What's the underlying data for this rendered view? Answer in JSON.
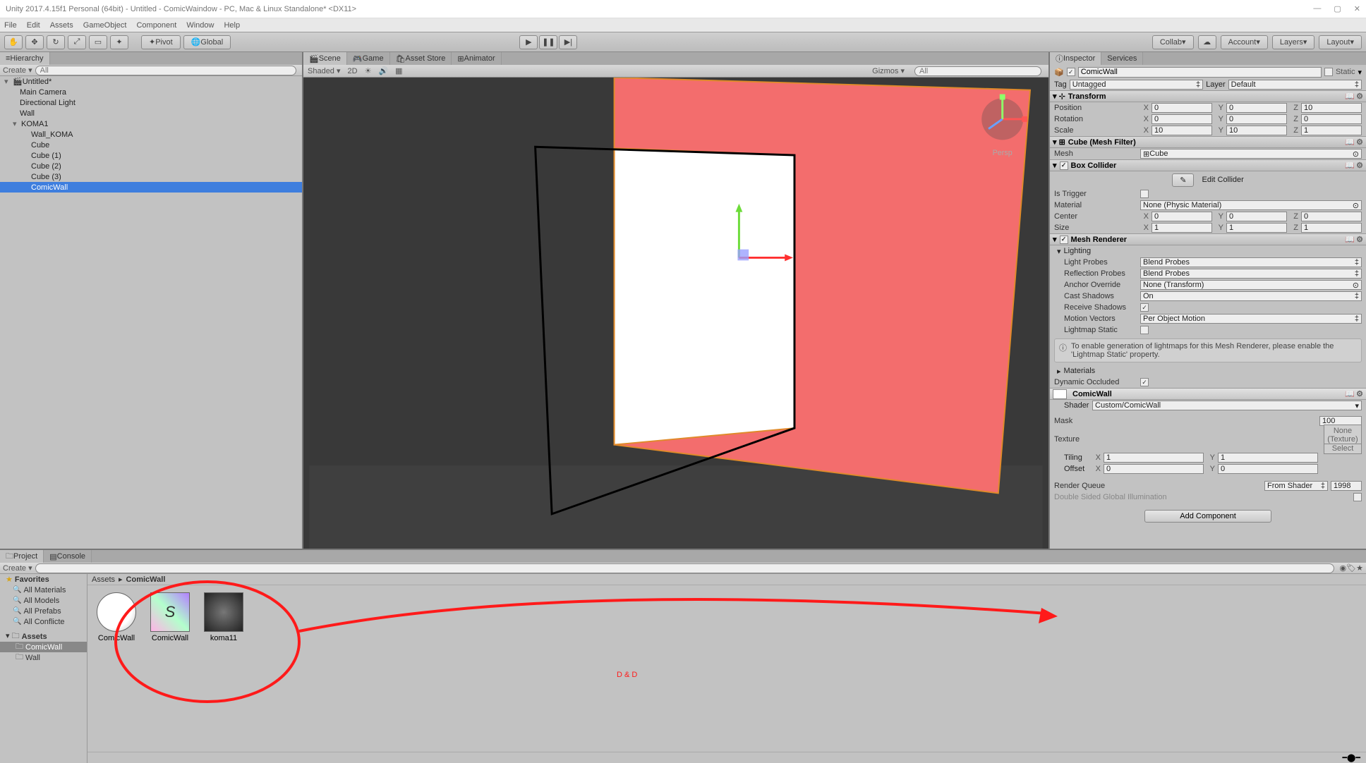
{
  "window": {
    "title": "Unity 2017.4.15f1 Personal (64bit) - Untitled - ComicWaindow - PC, Mac & Linux Standalone* <DX11>"
  },
  "menu": [
    "File",
    "Edit",
    "Assets",
    "GameObject",
    "Component",
    "Window",
    "Help"
  ],
  "toolbar": {
    "pivot": "Pivot",
    "global": "Global",
    "collab": "Collab",
    "account": "Account",
    "layers": "Layers",
    "layout": "Layout"
  },
  "hierarchy": {
    "title": "Hierarchy",
    "create": "Create",
    "search_placeholder": "All",
    "root": "Untitled*",
    "items": [
      "Main Camera",
      "Directional Light",
      "Wall"
    ],
    "koma_root": "KOMA1",
    "koma_items": [
      "Wall_KOMA",
      "Cube",
      "Cube (1)",
      "Cube (2)",
      "Cube (3)",
      "ComicWall"
    ]
  },
  "scene": {
    "tabs": [
      "Scene",
      "Game",
      "Asset Store",
      "Animator"
    ],
    "shading": "Shaded",
    "mode_2d": "2D",
    "gizmos": "Gizmos",
    "search_placeholder": "All",
    "persp": "Persp"
  },
  "inspector": {
    "tab1": "Inspector",
    "tab2": "Services",
    "object_name": "ComicWall",
    "static_label": "Static",
    "tag_label": "Tag",
    "tag_value": "Untagged",
    "layer_label": "Layer",
    "layer_value": "Default",
    "transform": {
      "title": "Transform",
      "pos_label": "Position",
      "pos": {
        "x": "0",
        "y": "0",
        "z": "10"
      },
      "rot_label": "Rotation",
      "rot": {
        "x": "0",
        "y": "0",
        "z": "0"
      },
      "scl_label": "Scale",
      "scl": {
        "x": "10",
        "y": "10",
        "z": "1"
      }
    },
    "mesh_filter": {
      "title": "Cube (Mesh Filter)",
      "mesh_label": "Mesh",
      "mesh_value": "Cube"
    },
    "box_collider": {
      "title": "Box Collider",
      "edit_label": "Edit Collider",
      "is_trigger": "Is Trigger",
      "material_label": "Material",
      "material_value": "None (Physic Material)",
      "center_label": "Center",
      "center": {
        "x": "0",
        "y": "0",
        "z": "0"
      },
      "size_label": "Size",
      "size": {
        "x": "1",
        "y": "1",
        "z": "1"
      }
    },
    "mesh_renderer": {
      "title": "Mesh Renderer",
      "lighting": "Lighting",
      "light_probes_lbl": "Light Probes",
      "light_probes": "Blend Probes",
      "refl_probes_lbl": "Reflection Probes",
      "refl_probes": "Blend Probes",
      "anchor_lbl": "Anchor Override",
      "anchor": "None (Transform)",
      "cast_lbl": "Cast Shadows",
      "cast": "On",
      "recv_lbl": "Receive Shadows",
      "motion_lbl": "Motion Vectors",
      "motion": "Per Object Motion",
      "lightmap_lbl": "Lightmap Static",
      "info": "To enable generation of lightmaps for this Mesh Renderer, please enable the 'Lightmap Static' property.",
      "materials": "Materials",
      "dyn_occ": "Dynamic Occluded"
    },
    "material": {
      "name": "ComicWall",
      "shader_lbl": "Shader",
      "shader_val": "Custom/ComicWall",
      "mask_lbl": "Mask",
      "mask_val": "100",
      "texture_lbl": "Texture",
      "texture_none": "None (Texture)",
      "select_lbl": "Select",
      "tiling_lbl": "Tiling",
      "tiling": {
        "x": "1",
        "y": "1"
      },
      "offset_lbl": "Offset",
      "offset": {
        "x": "0",
        "y": "0"
      },
      "rq_lbl": "Render Queue",
      "rq_mode": "From Shader",
      "rq_val": "1998",
      "dsgi": "Double Sided Global Illumination"
    },
    "add_component": "Add Component"
  },
  "project": {
    "tab1": "Project",
    "tab2": "Console",
    "create": "Create",
    "favorites": "Favorites",
    "fav_items": [
      "All Materials",
      "All Models",
      "All Prefabs",
      "All Conflicte"
    ],
    "assets": "Assets",
    "folders": [
      "ComicWall",
      "Wall"
    ],
    "crumb1": "Assets",
    "crumb2": "ComicWall",
    "grid": [
      "ComicWall",
      "ComicWall",
      "koma11"
    ]
  },
  "annotation_text": "D & D"
}
